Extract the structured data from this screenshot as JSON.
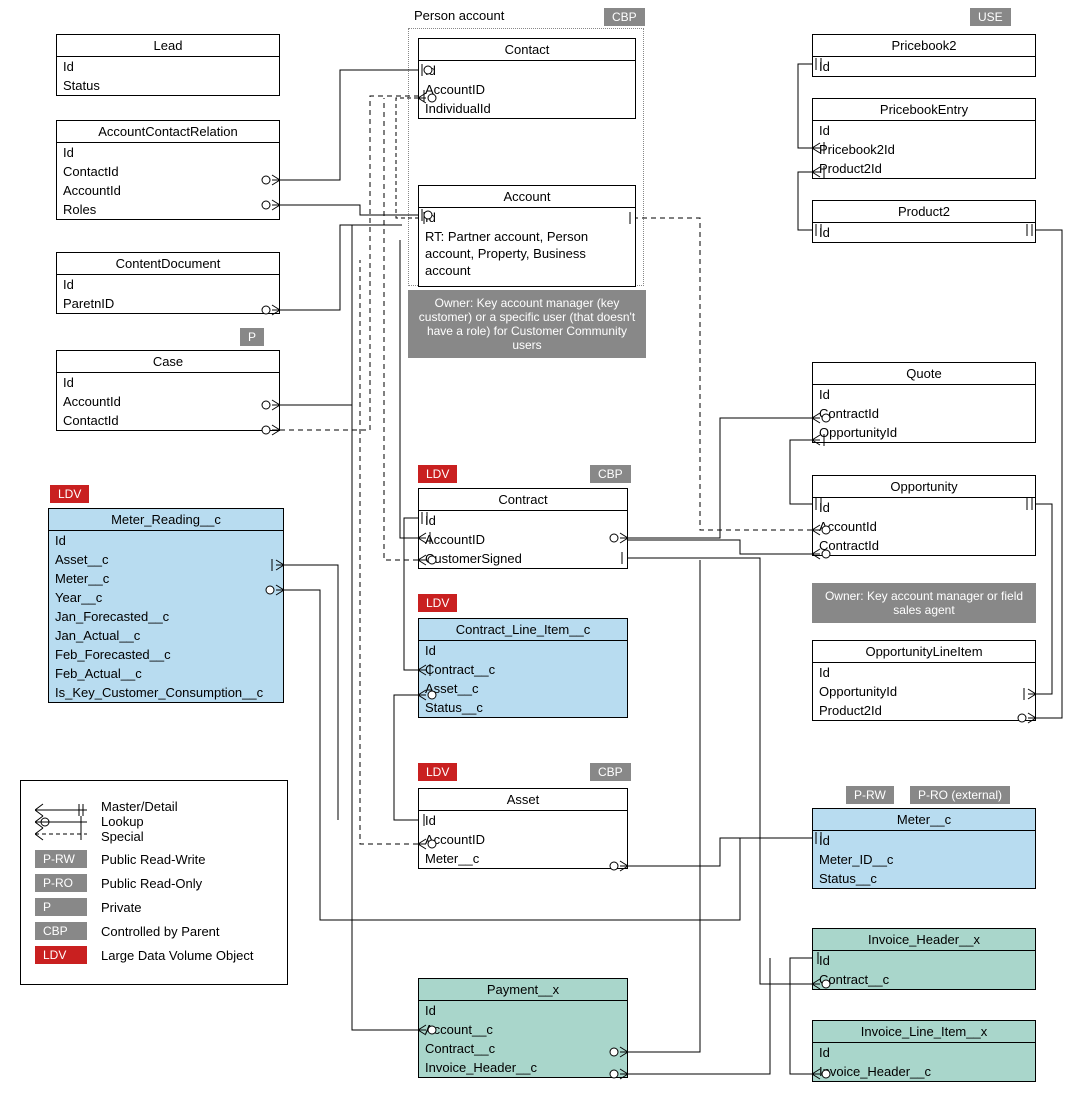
{
  "badges": {
    "cbp": "CBP",
    "use": "USE",
    "p": "P",
    "ldv": "LDV",
    "prw": "P-RW",
    "pro_ext": "P-RO (external)"
  },
  "labels": {
    "person_account": "Person account"
  },
  "notes": {
    "account_owner": "Owner: Key account manager (key customer) or a specific user (that doesn't have a role) for Customer Community users",
    "opp_owner": "Owner: Key account manager or field sales agent"
  },
  "entities": {
    "lead": {
      "title": "Lead",
      "fields": [
        "Id",
        "Status"
      ]
    },
    "acr": {
      "title": "AccountContactRelation",
      "fields": [
        "Id",
        "ContactId",
        "AccountId",
        "Roles"
      ]
    },
    "content_doc": {
      "title": "ContentDocument",
      "fields": [
        "Id",
        "ParetnID"
      ]
    },
    "case": {
      "title": "Case",
      "fields": [
        "Id",
        "AccountId",
        "ContactId"
      ]
    },
    "meter_reading": {
      "title": "Meter_Reading__c",
      "fields": [
        "Id",
        "Asset__c",
        "Meter__c",
        "Year__c",
        "Jan_Forecasted__c",
        "Jan_Actual__c",
        "Feb_Forecasted__c",
        "Feb_Actual__c",
        "Is_Key_Customer_Consumption__c"
      ]
    },
    "contact": {
      "title": "Contact",
      "fields": [
        "Id",
        "AccountID",
        "IndividualId"
      ]
    },
    "account": {
      "title": "Account",
      "fields": [
        "Id",
        "RT: Partner account, Person account, Property, Business account"
      ]
    },
    "contract": {
      "title": "Contract",
      "fields": [
        "Id",
        "AccountID",
        "CustomerSigned"
      ]
    },
    "cli": {
      "title": "Contract_Line_Item__c",
      "fields": [
        "Id",
        "Contract__c",
        "Asset__c",
        "Status__c"
      ]
    },
    "asset": {
      "title": "Asset",
      "fields": [
        "Id",
        "AccountID",
        "Meter__c"
      ]
    },
    "payment": {
      "title": "Payment__x",
      "fields": [
        "Id",
        "Account__c",
        "Contract__c",
        "Invoice_Header__c"
      ]
    },
    "pricebook2": {
      "title": "Pricebook2",
      "fields": [
        "Id"
      ]
    },
    "pbe": {
      "title": "PricebookEntry",
      "fields": [
        "Id",
        "Pricebook2Id",
        "Product2Id"
      ]
    },
    "product2": {
      "title": "Product2",
      "fields": [
        "Id"
      ]
    },
    "quote": {
      "title": "Quote",
      "fields": [
        "Id",
        "ContractId",
        "OpportunityId"
      ]
    },
    "opportunity": {
      "title": "Opportunity",
      "fields": [
        "Id",
        "AccountId",
        "ContractId"
      ]
    },
    "oli": {
      "title": "OpportunityLineItem",
      "fields": [
        "Id",
        "OpportunityId",
        "Product2Id"
      ]
    },
    "meter": {
      "title": "Meter__c",
      "fields": [
        "Id",
        "Meter_ID__c",
        "Status__c"
      ]
    },
    "invoice_header": {
      "title": "Invoice_Header__x",
      "fields": [
        "Id",
        "Contract__c"
      ]
    },
    "ili": {
      "title": "Invoice_Line_Item__x",
      "fields": [
        "Id",
        "Invoice_Header__c"
      ]
    }
  },
  "legend": {
    "rel": {
      "md": "Master/Detail",
      "lk": "Lookup",
      "sp": "Special"
    },
    "prw": "Public Read-Write",
    "pro": "Public Read-Only",
    "p": "Private",
    "cbp": "Controlled by Parent",
    "ldv": "Large Data Volume Object"
  }
}
